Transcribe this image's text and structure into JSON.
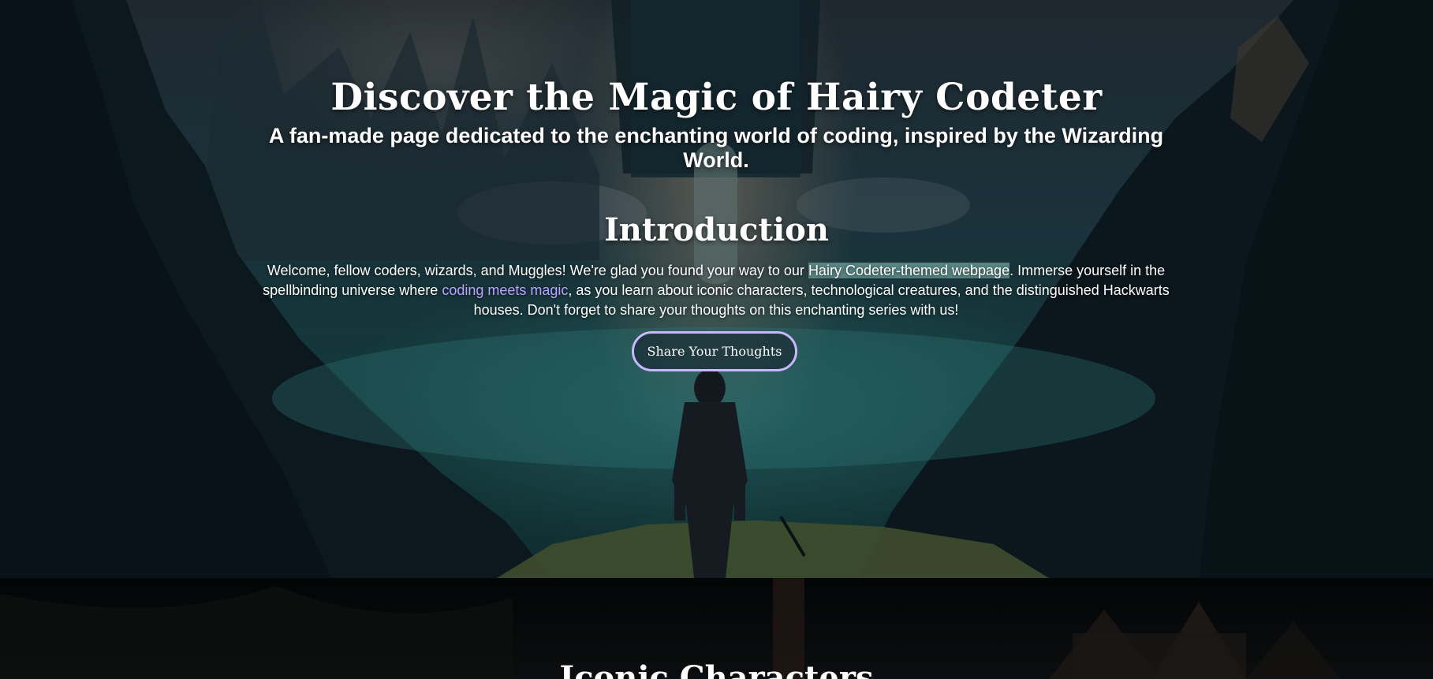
{
  "hero": {
    "title": "Discover the Magic of Hairy Codeter",
    "subtitle": "A fan-made page dedicated to the enchanting world of coding, inspired by the Wizarding World."
  },
  "intro": {
    "heading": "Introduction",
    "text_part1": "Welcome, fellow coders, wizards, and Muggles! We're glad you found your way to our ",
    "highlight": "Hairy Codeter-themed webpage",
    "text_part2": ". Immerse yourself in the spellbinding universe where ",
    "link": "coding meets magic",
    "text_part3": ", as you learn about iconic characters, technological creatures, and the distinguished Hackwarts houses. Don't forget to share your thoughts on this enchanting series with us!",
    "button_label": "Share Your Thoughts"
  },
  "characters_section": {
    "heading": "Iconic Characters"
  },
  "colors": {
    "link": "#b9a6ff",
    "button_border": "#c7b8ff",
    "highlight": "#6ea09b"
  }
}
